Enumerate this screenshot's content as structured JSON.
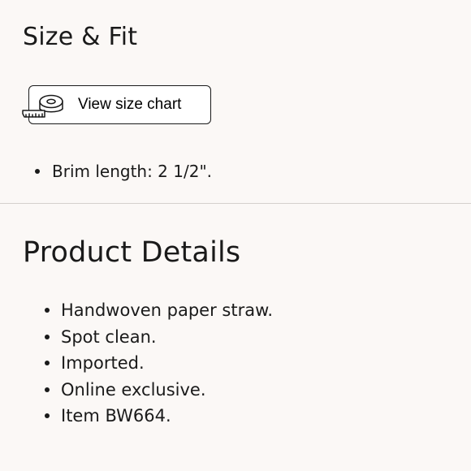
{
  "size_fit": {
    "title": "Size & Fit",
    "size_chart_button": {
      "label": "View size chart",
      "icon": "measuring-tape-icon"
    },
    "items": [
      "Brim length: 2 1/2\"."
    ]
  },
  "product_details": {
    "title": "Product Details",
    "items": [
      "Handwoven paper straw.",
      "Spot clean.",
      "Imported.",
      "Online exclusive.",
      "Item BW664."
    ]
  },
  "colors": {
    "background": "#fbf8f6",
    "text": "#1a1a1a",
    "divider": "#d4d0cd",
    "button_background": "#ffffff"
  }
}
